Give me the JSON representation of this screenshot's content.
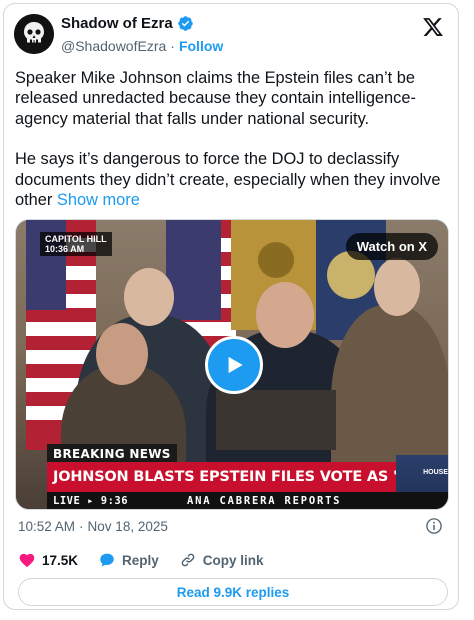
{
  "author": {
    "display_name": "Shadow of Ezra",
    "handle": "@ShadowofEzra",
    "separator": "·",
    "follow_label": "Follow",
    "verified_color": "#1d9bf0"
  },
  "tweet": {
    "paragraph_1": "Speaker Mike Johnson claims the Epstein files can’t be released unredacted because they contain intelligence-agency material that falls under national security.",
    "paragraph_2": "He says it’s dangerous to force the DOJ to declassify documents they didn’t create, especially when they involve other",
    "show_more": "Show more"
  },
  "media": {
    "watch_label": "Watch on X",
    "location_label": "CAPITOL HILL",
    "time_label": "10:36 AM",
    "breaking_label": "BREAKING NEWS",
    "headline": "JOHNSON BLASTS EPSTEIN FILES VOTE AS \"SHOW VOTE\"",
    "live_label": "LIVE ▸ 9:36",
    "reporter_label": "ANA CABRERA REPORTS",
    "side_label": "HOUSE"
  },
  "meta": {
    "time": "10:52 AM",
    "separator": "·",
    "date": "Nov 18, 2025"
  },
  "actions": {
    "likes": "17.5K",
    "reply_label": "Reply",
    "copy_label": "Copy link"
  },
  "read_replies_label": "Read 9.9K replies",
  "colors": {
    "accent": "#1d9bf0",
    "like": "#f91880",
    "headline_red": "#c8102e"
  }
}
